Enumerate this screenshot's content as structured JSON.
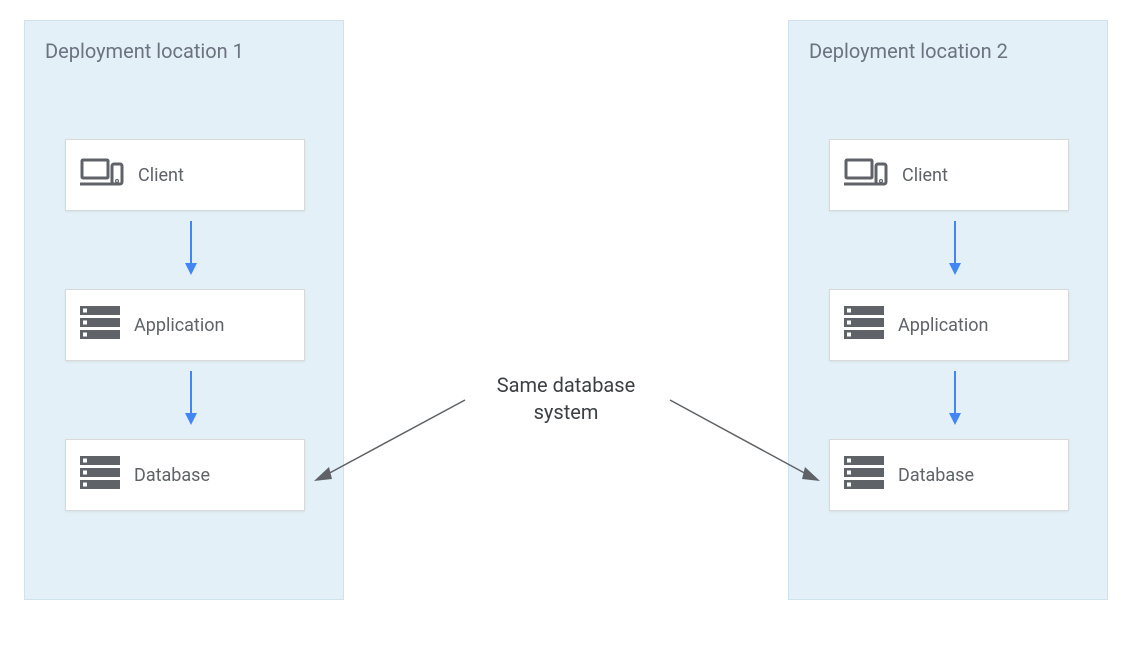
{
  "diagram": {
    "center_text_line1": "Same database",
    "center_text_line2": "system",
    "location1": {
      "title": "Deployment location 1",
      "nodes": [
        {
          "label": "Client",
          "icon": "client-icon"
        },
        {
          "label": "Application",
          "icon": "server-icon"
        },
        {
          "label": "Database",
          "icon": "server-icon"
        }
      ]
    },
    "location2": {
      "title": "Deployment location 2",
      "nodes": [
        {
          "label": "Client",
          "icon": "client-icon"
        },
        {
          "label": "Application",
          "icon": "server-icon"
        },
        {
          "label": "Database",
          "icon": "server-icon"
        }
      ]
    }
  },
  "colors": {
    "panel_bg": "#e3f0f7",
    "node_border": "#d9d9d9",
    "arrow_blue": "#4285F4",
    "arrow_gray": "#5f6368",
    "icon_fill": "#5f6368",
    "title_text": "#6b7280",
    "label_text": "#5f6368"
  }
}
